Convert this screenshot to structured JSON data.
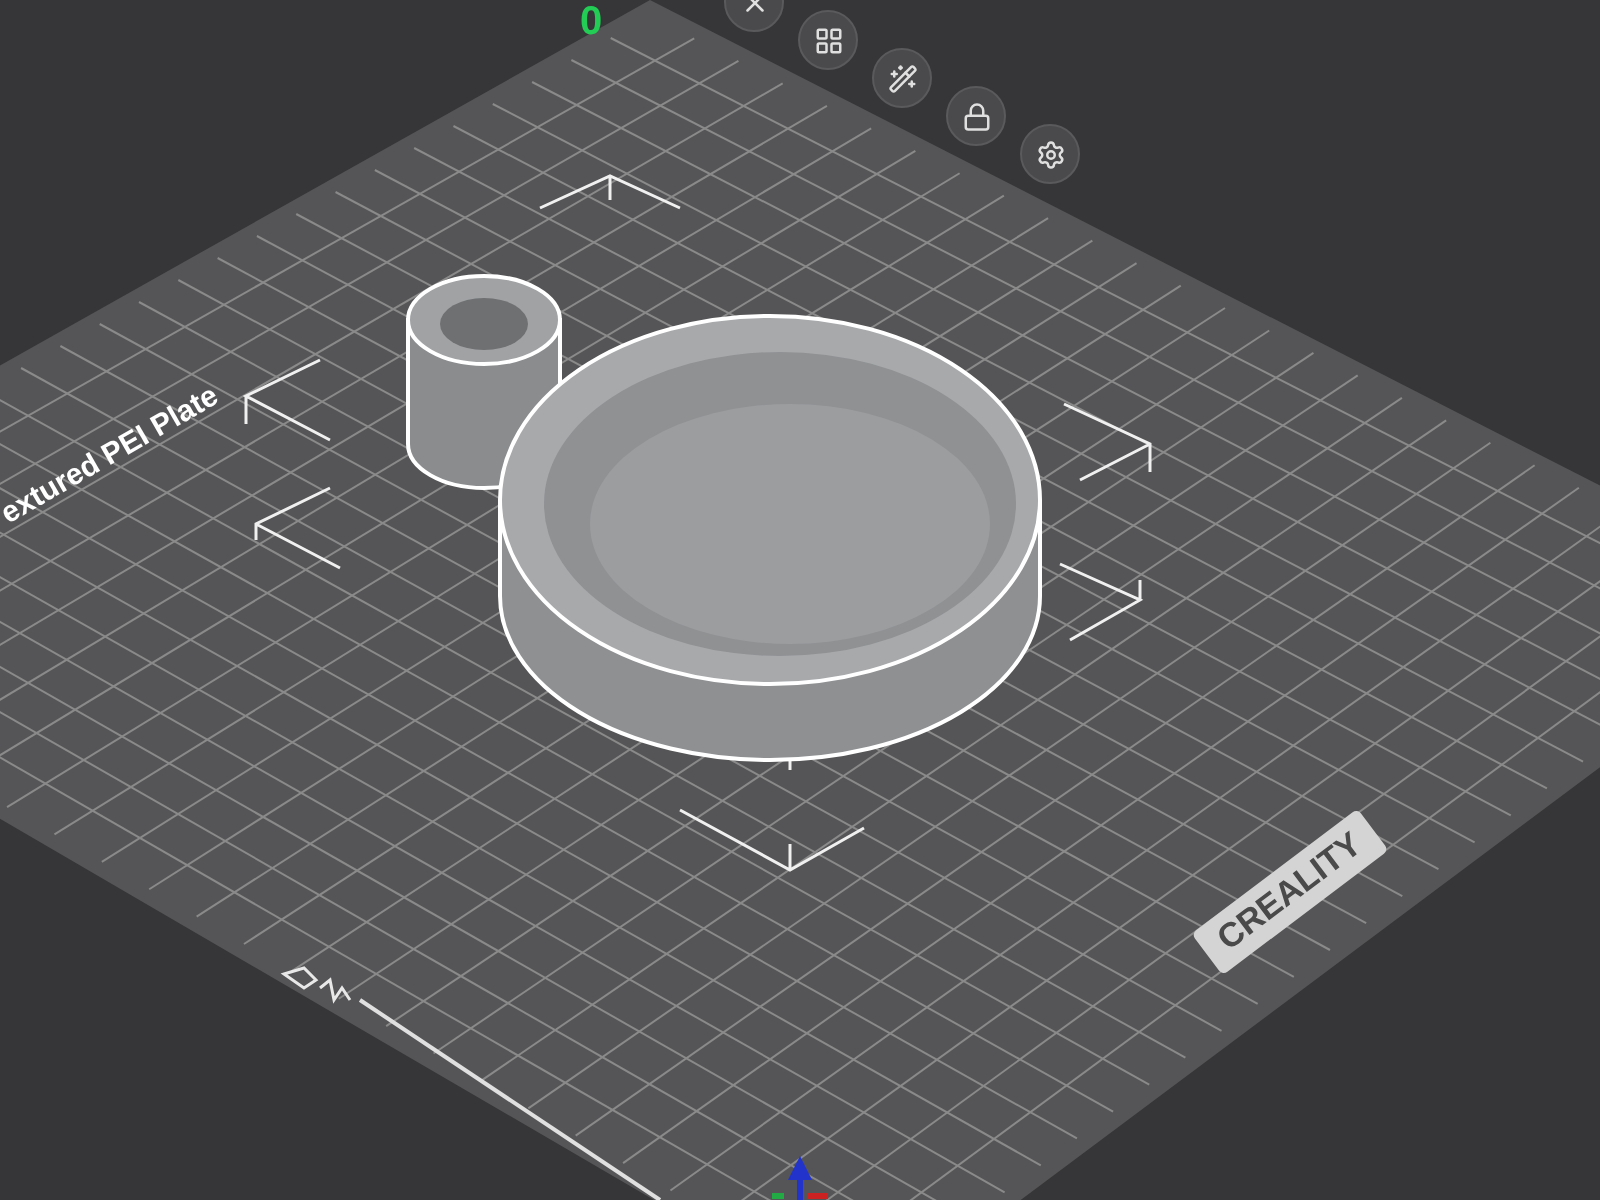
{
  "plate_number": "0",
  "plate_label": "extured PEI Plate",
  "bed_logo": "CREALITY",
  "toolbar": [
    {
      "kind": "close"
    },
    {
      "kind": "arrange"
    },
    {
      "kind": "orient"
    },
    {
      "kind": "lock"
    },
    {
      "kind": "settings"
    }
  ]
}
